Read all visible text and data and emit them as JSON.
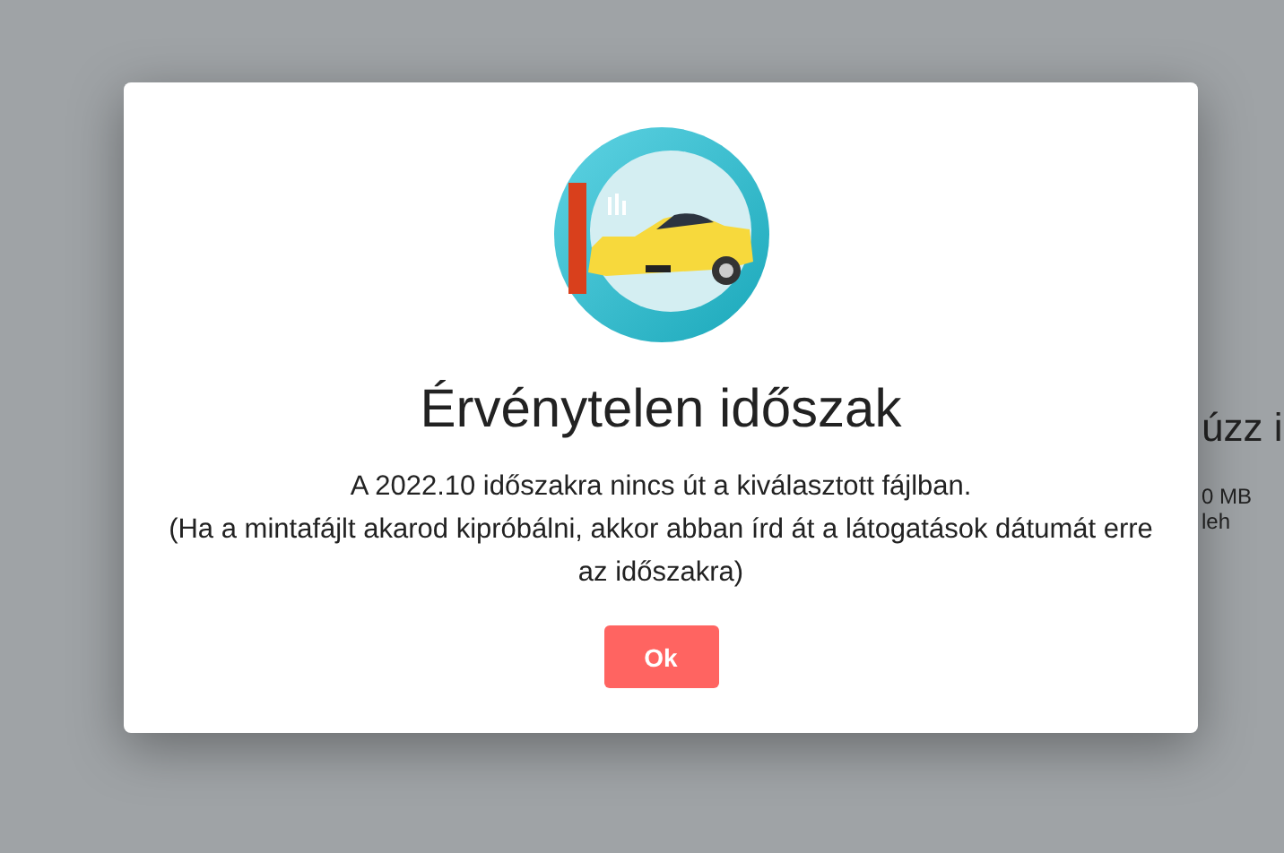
{
  "background": {
    "heading": "úzz i",
    "note": "0 MB leh"
  },
  "dialog": {
    "title": "Érvénytelen időszak",
    "message": [
      "A 2022.10 időszakra nincs út a kiválasztott fájlban.",
      "(Ha a mintafájlt akarod kipróbálni, akkor abban írd át a látogatások dátumát erre az időszakra)"
    ],
    "buttons": [
      "Ok"
    ]
  }
}
